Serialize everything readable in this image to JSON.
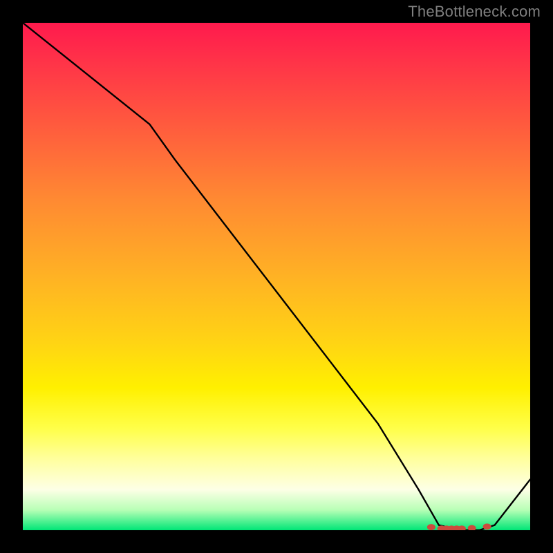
{
  "watermark": "TheBottleneck.com",
  "chart_data": {
    "type": "line",
    "title": "",
    "xlabel": "",
    "ylabel": "",
    "ylim": [
      0,
      100
    ],
    "xlim": [
      0,
      100
    ],
    "gradient_stops": [
      {
        "pos": 0,
        "color": "#ff1a4d"
      },
      {
        "pos": 8,
        "color": "#ff3448"
      },
      {
        "pos": 20,
        "color": "#ff5a3e"
      },
      {
        "pos": 35,
        "color": "#ff8a32"
      },
      {
        "pos": 50,
        "color": "#ffb224"
      },
      {
        "pos": 63,
        "color": "#ffd414"
      },
      {
        "pos": 72,
        "color": "#fff000"
      },
      {
        "pos": 80,
        "color": "#ffff4a"
      },
      {
        "pos": 86,
        "color": "#ffff9e"
      },
      {
        "pos": 92,
        "color": "#fdffe6"
      },
      {
        "pos": 96,
        "color": "#b8ffb6"
      },
      {
        "pos": 100,
        "color": "#00e676"
      }
    ],
    "series": [
      {
        "name": "curve",
        "x": [
          0,
          10,
          20,
          25,
          30,
          40,
          50,
          60,
          70,
          78,
          82,
          86,
          90,
          93,
          100
        ],
        "y": [
          100,
          92,
          84,
          80,
          73,
          60,
          47,
          34,
          21,
          8,
          1,
          0,
          0,
          1,
          10
        ]
      }
    ],
    "markers": {
      "name": "baseline-dots",
      "color": "#cc4b3d",
      "x": [
        80.5,
        82.5,
        83.5,
        84.5,
        85.5,
        86.5,
        88.5,
        91.5
      ],
      "y": [
        0.6,
        0.3,
        0.3,
        0.3,
        0.3,
        0.3,
        0.4,
        0.7
      ]
    }
  }
}
